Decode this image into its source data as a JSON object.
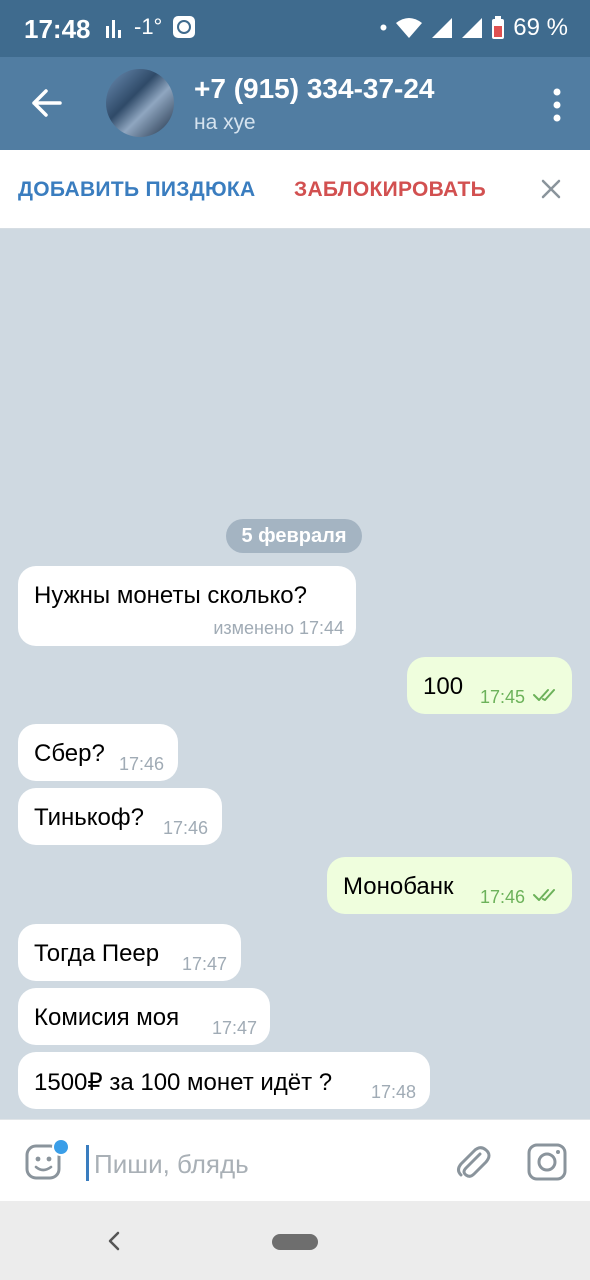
{
  "status_bar": {
    "time": "17:48",
    "temperature": "-1°",
    "battery": "69 %"
  },
  "header": {
    "title": "+7 (915) 334-37-24",
    "subtitle": "на хуе"
  },
  "actions": {
    "add_label": "ДОБАВИТЬ ПИЗДЮКА",
    "block_label": "ЗАБЛОКИРОВАТЬ"
  },
  "chat": {
    "date": "5 февраля",
    "messages": [
      {
        "direction": "in",
        "text": "Нужны монеты сколько?",
        "time": "изменено 17:44"
      },
      {
        "direction": "out",
        "text": "100",
        "time": "17:45"
      },
      {
        "direction": "in",
        "text": "Сбер?",
        "time": "17:46"
      },
      {
        "direction": "in",
        "text": "Тинькоф?",
        "time": "17:46"
      },
      {
        "direction": "out",
        "text": "Монобанк",
        "time": "17:46"
      },
      {
        "direction": "in",
        "text": "Тогда Пеер",
        "time": "17:47"
      },
      {
        "direction": "in",
        "text": "Комисия моя",
        "time": "17:47"
      },
      {
        "direction": "in",
        "text": "1500₽ за 100 монет идёт ?",
        "time": "17:48"
      }
    ]
  },
  "composer": {
    "placeholder": "Пиши, блядь"
  },
  "colors": {
    "header": "#517da2",
    "status_bar": "#3f6b8e",
    "chat_bg": "#cfd9e1",
    "outgoing_bubble": "#effedd",
    "accent": "#3a7dbf",
    "danger": "#d25050"
  }
}
